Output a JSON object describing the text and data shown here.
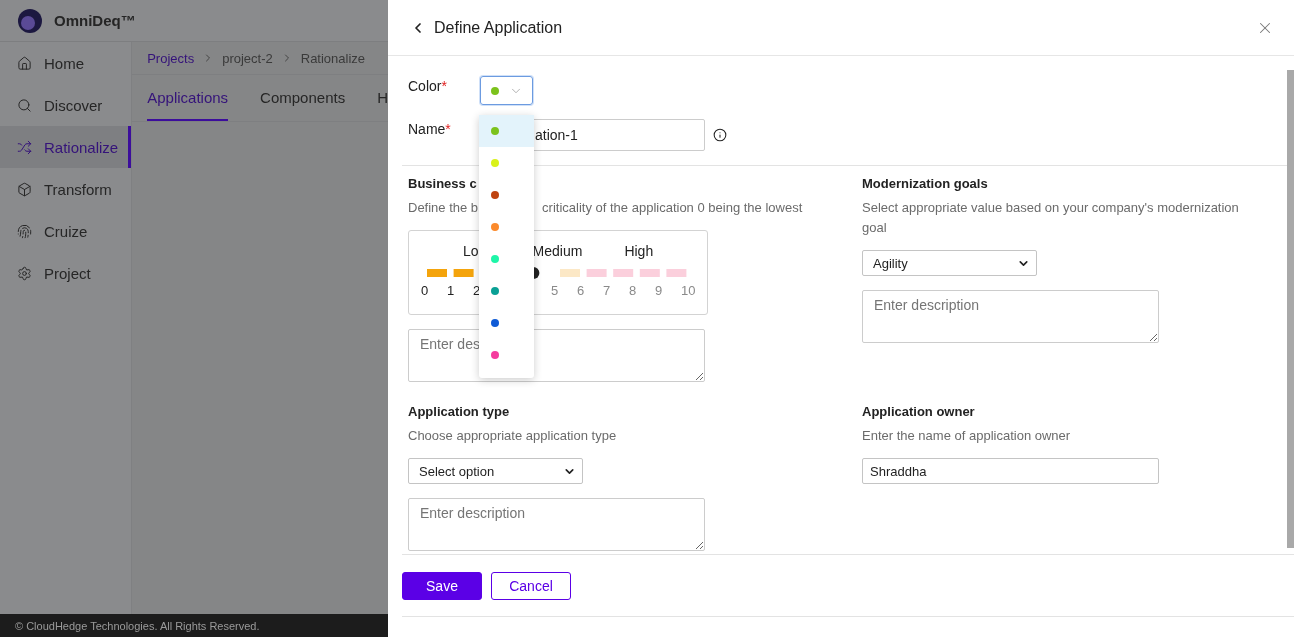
{
  "app": {
    "name": "OmniDeq™"
  },
  "sidebar": {
    "items": [
      {
        "label": "Home",
        "selected": false
      },
      {
        "label": "Discover",
        "selected": false
      },
      {
        "label": "Rationalize",
        "selected": true
      },
      {
        "label": "Transform",
        "selected": false
      },
      {
        "label": "Cruize",
        "selected": false
      },
      {
        "label": "Project",
        "selected": false
      }
    ]
  },
  "breadcrumbs": [
    {
      "label": "Projects",
      "link": true
    },
    {
      "label": "project-2",
      "link": false
    },
    {
      "label": "Rationalize",
      "link": false
    }
  ],
  "tabs": [
    {
      "label": "Applications",
      "selected": true
    },
    {
      "label": "Components",
      "selected": false
    },
    {
      "label": "H",
      "selected": false
    }
  ],
  "footer": {
    "text": "© CloudHedge Technologies. All Rights Reserved."
  },
  "panel": {
    "title": "Define Application",
    "color": {
      "label": "Color",
      "required_mark": "*",
      "options": [
        {
          "color": "#7cc21c",
          "selected": true
        },
        {
          "color": "#d9f21a",
          "selected": false
        },
        {
          "color": "#bf4310",
          "selected": false
        },
        {
          "color": "#fb8a2c",
          "selected": false
        },
        {
          "color": "#1ef5a8",
          "selected": false
        },
        {
          "color": "#0aa095",
          "selected": false
        },
        {
          "color": "#0f5bd6",
          "selected": false
        },
        {
          "color": "#f53b9e",
          "selected": false
        }
      ]
    },
    "name": {
      "label": "Name",
      "required_mark": "*",
      "value": "ation-1"
    },
    "criticality": {
      "title": "Business c",
      "description_start": "Define the b",
      "description_end": "criticality of the application 0 being the lowest",
      "labels": [
        "Lo",
        "Medium",
        "High"
      ],
      "level": 0.4,
      "ticks_start": [
        "0",
        "1",
        "2"
      ],
      "ticks_end": [
        "5",
        "6",
        "7",
        "8",
        "9",
        "10"
      ],
      "placeholder": "Enter des"
    },
    "goals": {
      "title": "Modernization goals",
      "description": "Select appropriate value based on your company's modernization goal",
      "value": "Agility",
      "placeholder": "Enter description"
    },
    "app_type": {
      "title": "Application type",
      "description": "Choose appropriate application type",
      "value": "Select option",
      "placeholder": "Enter description"
    },
    "owner": {
      "title": "Application owner",
      "description": "Enter the name of application owner",
      "value": "Shraddha"
    },
    "buttons": [
      {
        "label": "Save",
        "kind": "primary"
      },
      {
        "label": "Cancel",
        "kind": "secondary"
      }
    ]
  }
}
